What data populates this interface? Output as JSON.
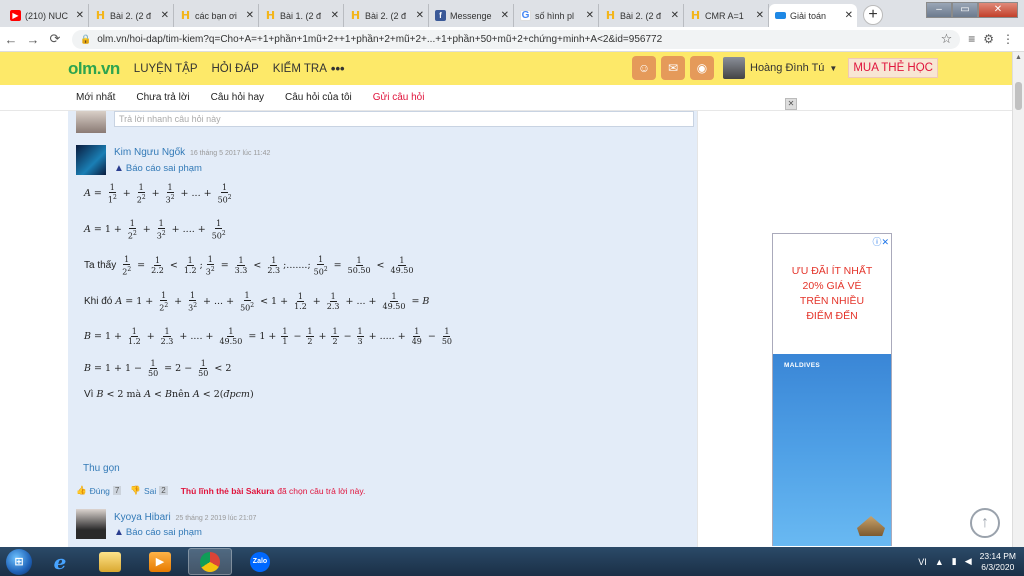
{
  "browser": {
    "tabs": [
      {
        "title": "(210) NUC",
        "icon": "youtube-icon",
        "fav": "▶",
        "favclass": "fav-yt",
        "active": false
      },
      {
        "title": "Bài 2. (2 đ",
        "icon": "olm-h-icon",
        "fav": "H",
        "favclass": "fav-h",
        "active": false
      },
      {
        "title": "các bạn ơi",
        "icon": "olm-h-icon",
        "fav": "H",
        "favclass": "fav-h",
        "active": false
      },
      {
        "title": "Bài 1. (2 đ",
        "icon": "olm-h-icon",
        "fav": "H",
        "favclass": "fav-h",
        "active": false
      },
      {
        "title": "Bài 2. (2 đ",
        "icon": "olm-h-icon",
        "fav": "H",
        "favclass": "fav-h",
        "active": false
      },
      {
        "title": "Messenge",
        "icon": "facebook-icon",
        "fav": "f",
        "favclass": "fav-fb",
        "active": false
      },
      {
        "title": "số hình pl",
        "icon": "google-icon",
        "fav": "G",
        "favclass": "fav-g",
        "active": false
      },
      {
        "title": "Bài 2. (2 đ",
        "icon": "olm-h-icon",
        "fav": "H",
        "favclass": "fav-h",
        "active": false
      },
      {
        "title": "CMR A=1",
        "icon": "olm-h-icon",
        "fav": "H",
        "favclass": "fav-h",
        "active": false
      },
      {
        "title": "Giải toán",
        "icon": "cloud-icon",
        "fav": "",
        "favclass": "fav-cloud",
        "active": true
      }
    ],
    "url": "olm.vn/hoi-dap/tim-kiem?q=Cho+A=+1+phần+1mũ+2++1+phần+2+mũ+2+...+1+phần+50+mũ+2+chứng+minh+A<2&id=956772"
  },
  "site": {
    "logo_main": "olm",
    "logo_suffix": ".vn",
    "nav": [
      "LUYỆN TẬP",
      "HỎI ĐÁP",
      "KIỂM TRA"
    ],
    "more": "•••",
    "username": "Hoàng Đình Tú",
    "buy_card": "MUA THẺ HỌC",
    "subnav": [
      {
        "label": "Mới nhất",
        "red": false
      },
      {
        "label": "Chưa trả lời",
        "red": false
      },
      {
        "label": "Câu hỏi hay",
        "red": false
      },
      {
        "label": "Câu hỏi của tôi",
        "red": false
      },
      {
        "label": "Gửi câu hỏi",
        "red": true
      }
    ]
  },
  "answer": {
    "reply_placeholder": "Trả lời nhanh câu hỏi này",
    "author": "Kim Ngưu Ngốk",
    "timestamp": "16 tháng 5 2017 lúc 11:42",
    "report": "Báo cáo sai phạm",
    "line4_prefix": "Ta thấy",
    "line5_prefix": "Khi đó",
    "line8_prefix": "Vì",
    "collapse": "Thu gọn",
    "like_label": "Đúng",
    "like_count": "7",
    "dislike_label": "Sai",
    "dislike_count": "2",
    "chosen_by": "Thủ lĩnh thẻ bài Sakura",
    "chosen_text": "đã chọn câu trả lời này."
  },
  "answer2": {
    "author": "Kyoya Hibari",
    "timestamp": "25 tháng 2 2019 lúc 21:07",
    "report": "Báo cáo sai phạm"
  },
  "ad": {
    "line1": "ƯU ĐÃI ÍT NHẤT",
    "line2": "20% GIÁ VÉ",
    "line3": "TRÊN NHIỀU",
    "line4": "ĐIỂM ĐẾN",
    "destination": "MALDIVES"
  },
  "taskbar": {
    "lang": "VI",
    "time": "23:14 PM",
    "date": "6/3/2020"
  }
}
